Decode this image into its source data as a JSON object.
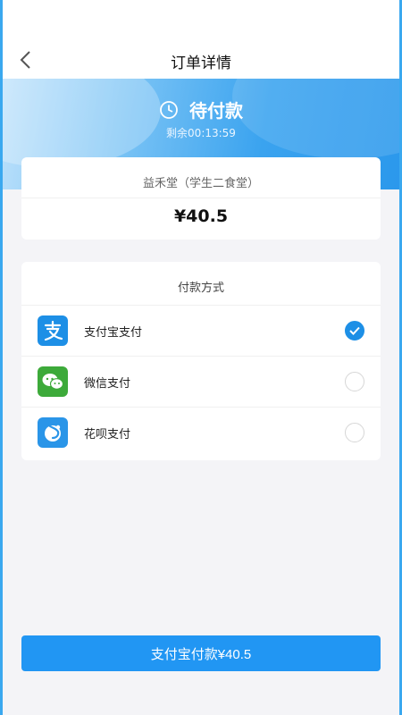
{
  "header": {
    "title": "订单详情",
    "back_icon": "chevron-left-icon"
  },
  "status": {
    "icon": "clock-icon",
    "label": "待付款",
    "countdown": "剩余00:13:59"
  },
  "order": {
    "shop_name": "益禾堂（学生二食堂）",
    "amount": "¥40.5"
  },
  "payment": {
    "title": "付款方式",
    "methods": [
      {
        "label": "支付宝支付",
        "icon": "alipay-icon",
        "color": "#1d8fe6",
        "selected": true
      },
      {
        "label": "微信支付",
        "icon": "wechat-icon",
        "color": "#3daa3a",
        "selected": false
      },
      {
        "label": "花呗支付",
        "icon": "huabei-icon",
        "color": "#2a95e8",
        "selected": false
      }
    ]
  },
  "action": {
    "pay_label": "支付宝付款¥40.5"
  },
  "colors": {
    "accent": "#2196f3",
    "frame": "#3aa8ef"
  }
}
